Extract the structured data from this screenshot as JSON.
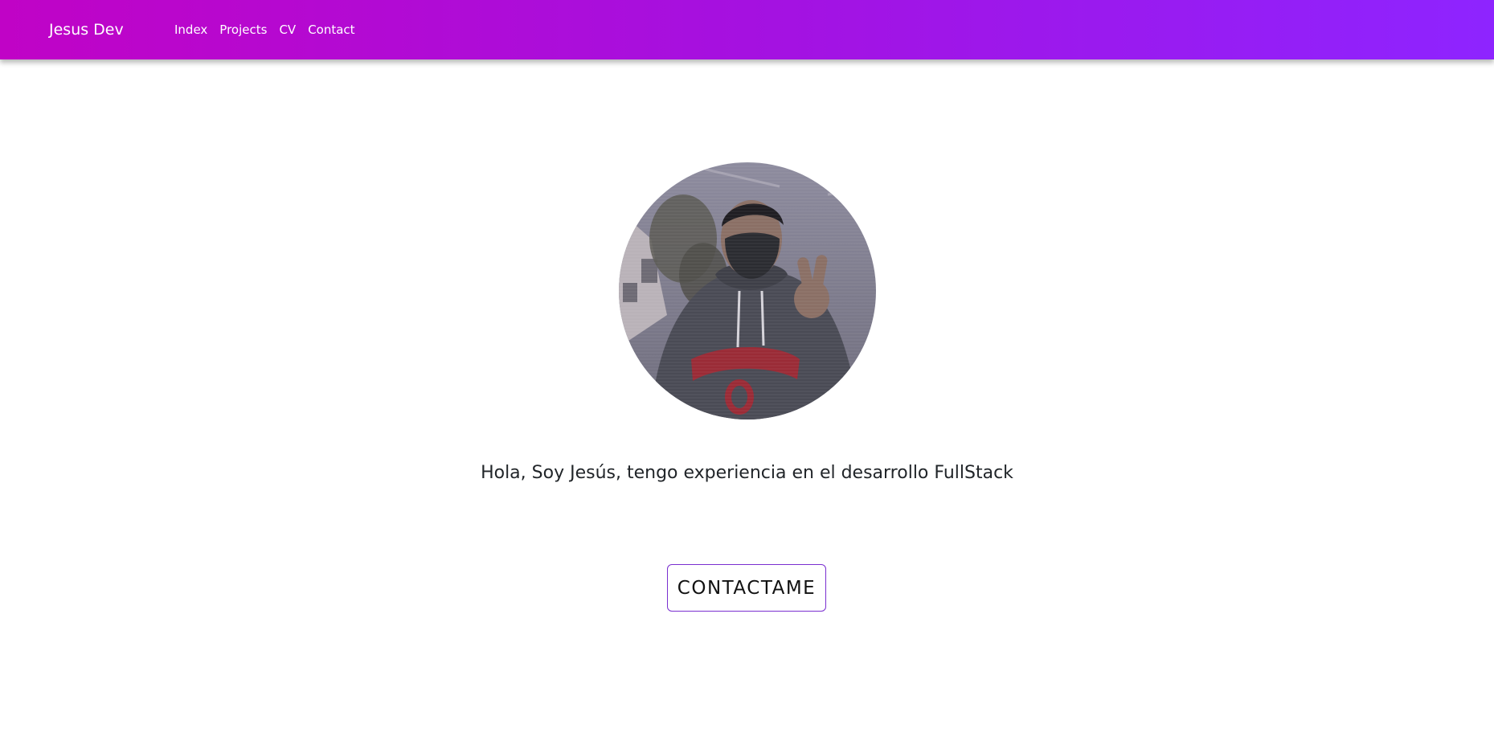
{
  "navbar": {
    "brand": "Jesus Dev",
    "links": [
      "Index",
      "Projects",
      "CV",
      "Contact"
    ]
  },
  "hero": {
    "avatar_alt": "profile-photo",
    "intro": "Hola, Soy Jesús, tengo experiencia en el desarrollo FullStack",
    "button_label": "CONTACTAME"
  },
  "colors": {
    "nav_start": "#c003c6",
    "nav_end": "#8e24ff",
    "button_border": "#7a2fd0",
    "text": "#212529"
  }
}
